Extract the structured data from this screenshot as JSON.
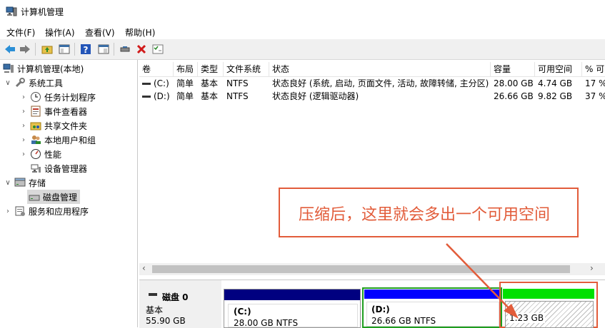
{
  "window": {
    "title": "计算机管理"
  },
  "menu": [
    "文件(F)",
    "操作(A)",
    "查看(V)",
    "帮助(H)"
  ],
  "toolbar": {
    "icons": [
      "back-arrow-icon",
      "forward-arrow-icon",
      "folder-up-icon",
      "console-tree-icon",
      "help-icon",
      "properties-icon",
      "connect-icon",
      "delete-icon",
      "checklist-icon"
    ]
  },
  "tree": {
    "root": "计算机管理(本地)",
    "system_tools": "系统工具",
    "task_scheduler": "任务计划程序",
    "event_viewer": "事件查看器",
    "shared_folders": "共享文件夹",
    "local_users": "本地用户和组",
    "performance": "性能",
    "device_manager": "设备管理器",
    "storage": "存储",
    "disk_management": "磁盘管理",
    "services": "服务和应用程序"
  },
  "table": {
    "headers": [
      "卷",
      "布局",
      "类型",
      "文件系统",
      "状态",
      "容量",
      "可用空间",
      "% 可"
    ],
    "rows": [
      [
        "(C:)",
        "简单",
        "基本",
        "NTFS",
        "状态良好 (系统, 启动, 页面文件, 活动, 故障转储, 主分区)",
        "28.00 GB",
        "4.74 GB",
        "17 %"
      ],
      [
        "(D:)",
        "简单",
        "基本",
        "NTFS",
        "状态良好 (逻辑驱动器)",
        "26.66 GB",
        "9.82 GB",
        "37 %"
      ]
    ]
  },
  "disk": {
    "name": "磁盘 0",
    "type": "基本",
    "size": "55.90 GB",
    "partitions": [
      {
        "label": "(C:)",
        "info": "28.00 GB NTFS",
        "color": "#000080"
      },
      {
        "label": "(D:)",
        "info": "26.66 GB NTFS",
        "color": "#0000ff"
      },
      {
        "label": "",
        "info": "1.23 GB",
        "color": "#00e000"
      }
    ]
  },
  "annotation": {
    "text": "压缩后，这里就会多出一个可用空间",
    "color": "#e25c3a"
  },
  "colors": {
    "accent": "#e25c3a",
    "selection": "#d9d9d9"
  }
}
